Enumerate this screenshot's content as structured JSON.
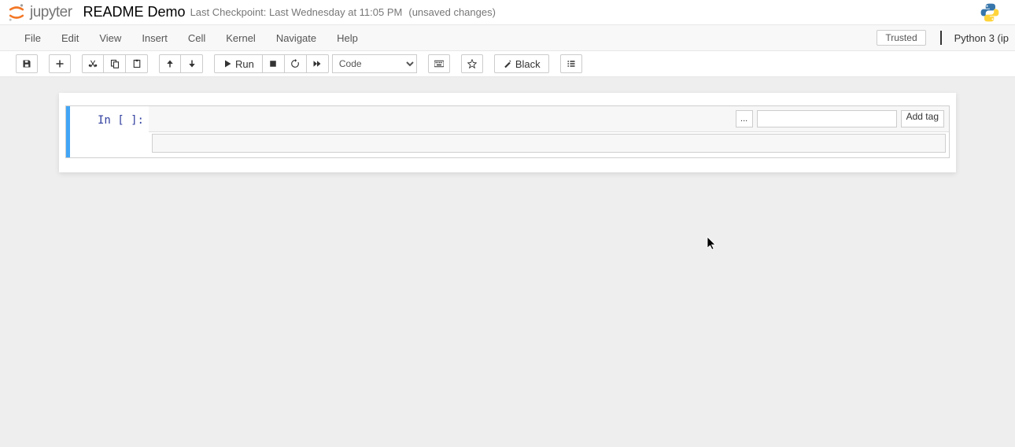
{
  "header": {
    "logo_text": "jupyter",
    "notebook_name": "README Demo",
    "checkpoint": "Last Checkpoint: Last Wednesday at 11:05 PM",
    "unsaved": "(unsaved changes)"
  },
  "menubar": {
    "items": [
      "File",
      "Edit",
      "View",
      "Insert",
      "Cell",
      "Kernel",
      "Navigate",
      "Help"
    ],
    "trusted": "Trusted",
    "kernel": "Python 3 (ip"
  },
  "toolbar": {
    "run_label": "Run",
    "black_label": "Black",
    "celltype": "Code"
  },
  "cell": {
    "prompt": "In [ ]:",
    "tag_ellipsis": "...",
    "tag_add": "Add tag",
    "tag_placeholder": ""
  },
  "icons": {
    "save": "save-icon",
    "add": "plus-icon",
    "cut": "scissors-icon",
    "copy": "copy-icon",
    "paste": "paste-icon",
    "up": "arrow-up-icon",
    "down": "arrow-down-icon",
    "play": "play-icon",
    "stop": "stop-icon",
    "restart": "restart-icon",
    "ff": "fast-forward-icon",
    "keyboard": "keyboard-icon",
    "command": "command-palette-icon",
    "magic": "magic-icon",
    "list": "list-icon"
  }
}
